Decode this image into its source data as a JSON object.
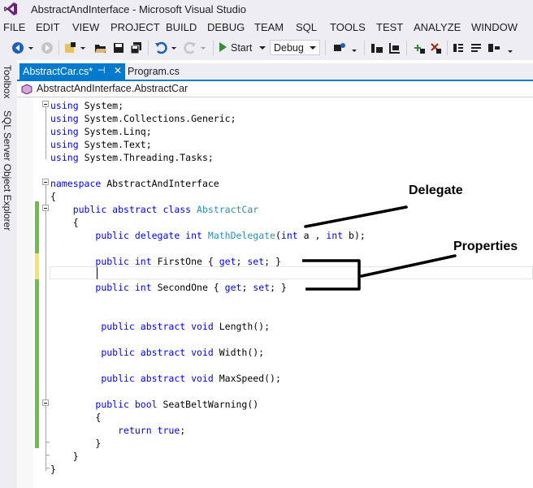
{
  "window": {
    "title": "AbstractAndInterface - Microsoft Visual Studio"
  },
  "menu": [
    "FILE",
    "EDIT",
    "VIEW",
    "PROJECT",
    "BUILD",
    "DEBUG",
    "TEAM",
    "SQL",
    "TOOLS",
    "TEST",
    "ANALYZE",
    "WINDOW"
  ],
  "toolbar": {
    "start_label": "Start",
    "config_value": "Debug"
  },
  "side_tabs": [
    "Toolbox",
    "SQL Server Object Explorer"
  ],
  "tabs": [
    {
      "label": "AbstractCar.cs*",
      "active": true
    },
    {
      "label": "Program.cs",
      "active": false
    }
  ],
  "navbar": {
    "type_path": "AbstractAndInterface.AbstractCar"
  },
  "code": {
    "using_kw": "using",
    "usings": [
      "System;",
      "System.Collections.Generic;",
      "System.Linq;",
      "System.Text;",
      "System.Threading.Tasks;"
    ],
    "namespace_kw": "namespace",
    "namespace_name": "AbstractAndInterface",
    "open_brace": "{",
    "close_brace": "}",
    "class_mods": "public abstract class",
    "class_name": "AbstractCar",
    "delegate_mods": "public delegate int",
    "delegate_name": "MathDelegate",
    "delegate_params_1": "(",
    "delegate_int_a": "int",
    "delegate_params_2": " a , ",
    "delegate_int_b": "int",
    "delegate_params_3": " b);",
    "prop1_mods": "public int",
    "prop1_name": " FirstOne { ",
    "prop1_get": "get",
    "prop1_mid": "; ",
    "prop1_set": "set",
    "prop1_end": "; }",
    "prop2_mods": "public int",
    "prop2_name": " SecondOne { ",
    "prop2_get": "get",
    "prop2_mid": "; ",
    "prop2_set": "set",
    "prop2_end": "; }",
    "m1_mods": "public abstract void",
    "m1_rest": " Length();",
    "m2_mods": "public abstract void",
    "m2_rest": " Width();",
    "m3_mods": "public abstract void",
    "m3_rest": " MaxSpeed();",
    "m4_mods": "public bool",
    "m4_rest": " SeatBeltWarning()",
    "return_kw": "return",
    "return_val": "true",
    "return_end": ";"
  },
  "annotations": {
    "delegate_label": "Delegate",
    "properties_label": "Properties"
  },
  "colors": {
    "accent": "#007acc",
    "keyword": "#0000ff",
    "type": "#2b91af",
    "chrome": "#eeeef2",
    "change_saved": "#6cc04a",
    "change_unsaved": "#f4e36c"
  },
  "icons": [
    "vs-logo-icon",
    "back-icon",
    "forward-icon",
    "new-project-icon",
    "open-icon",
    "save-icon",
    "save-all-icon",
    "undo-icon",
    "redo-icon",
    "start-icon",
    "attach-icon",
    "find-icon",
    "bookmark-icon",
    "breakpoint-icon",
    "pin-icon",
    "close-icon",
    "class-icon"
  ]
}
